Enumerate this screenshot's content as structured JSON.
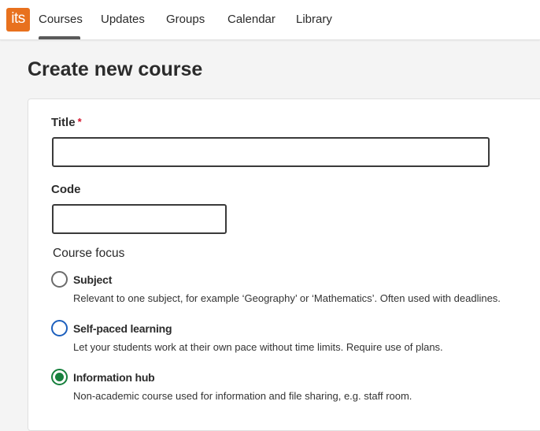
{
  "header": {
    "logo_text": "its",
    "nav": [
      {
        "label": "Courses",
        "active": true
      },
      {
        "label": "Updates"
      },
      {
        "label": "Groups"
      },
      {
        "label": "Calendar"
      },
      {
        "label": "Library"
      }
    ]
  },
  "page": {
    "title": "Create new course"
  },
  "form": {
    "title_label": "Title",
    "required_marker": "*",
    "title_value": "",
    "code_label": "Code",
    "code_value": "",
    "focus_label": "Course focus",
    "options": [
      {
        "label": "Subject",
        "description": "Relevant to one subject, for example ‘Geography’ or ‘Mathematics’. Often used with deadlines.",
        "checked": false
      },
      {
        "label": "Self-paced learning",
        "description": "Let your students work at their own pace without time limits. Require use of plans.",
        "checked": false
      },
      {
        "label": "Information hub",
        "description": "Non-academic course used for information and file sharing, e.g. staff room.",
        "checked": true
      }
    ]
  },
  "colors": {
    "brand": "#e8711e",
    "selected_radio": "#17803d",
    "focus_ring": "#1c5fbd",
    "required": "#d3122b"
  }
}
